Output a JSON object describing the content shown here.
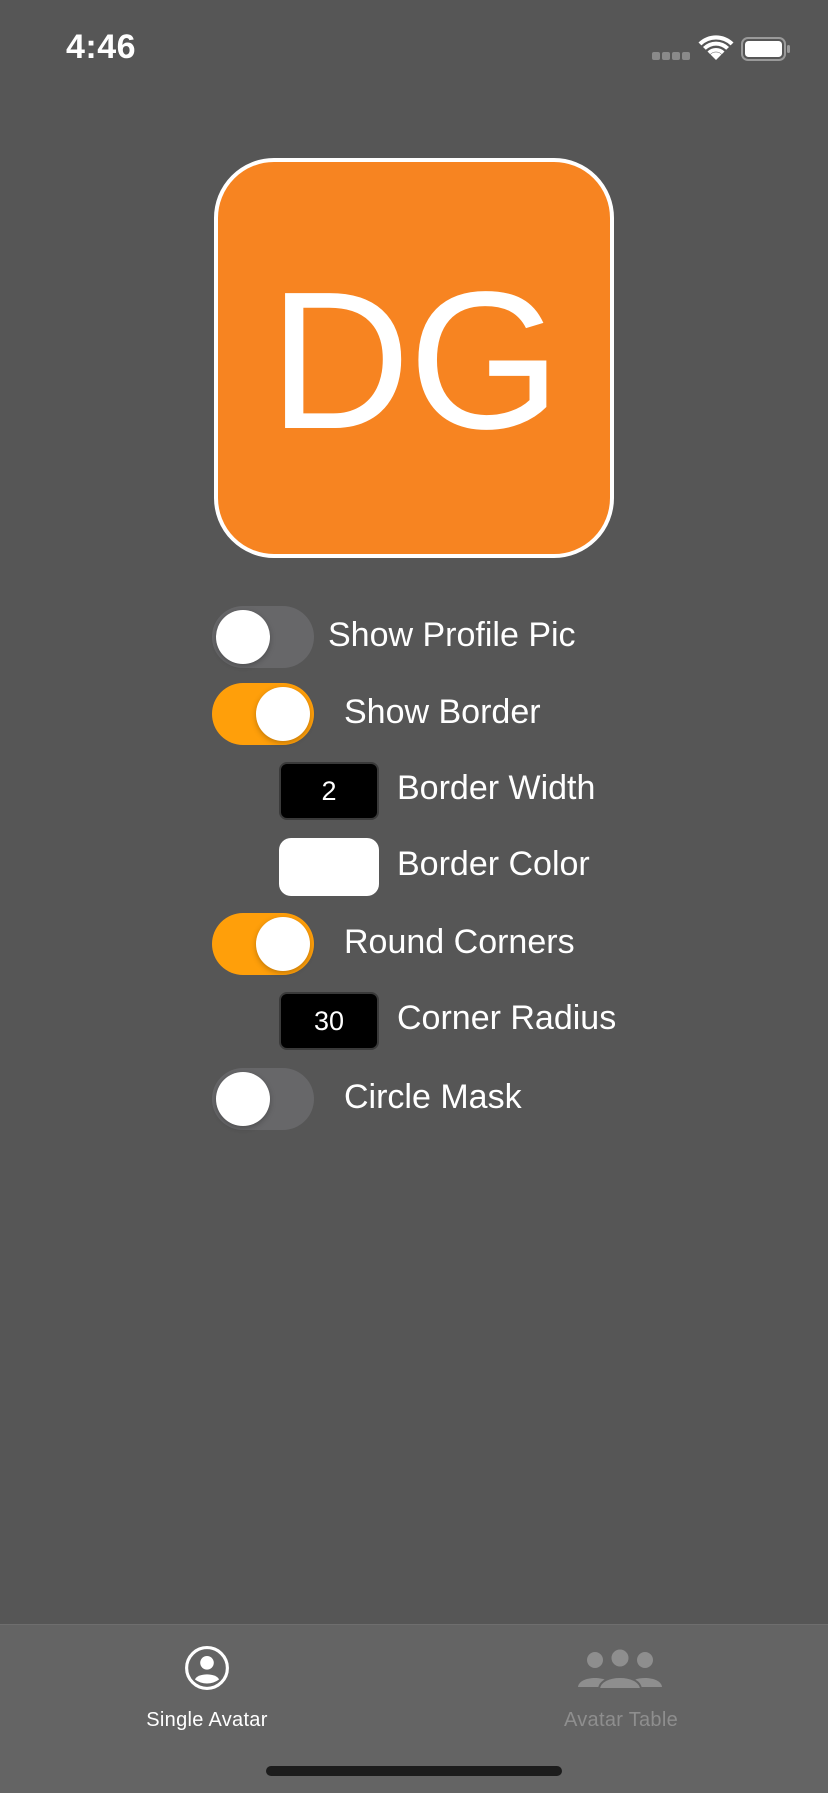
{
  "status_bar": {
    "time": "4:46",
    "icons": [
      "cellular-signal-icon",
      "wifi-icon",
      "battery-icon"
    ]
  },
  "avatar": {
    "initials": "DG",
    "background_color": "#F78421",
    "border_color": "#FFFFFF"
  },
  "options": {
    "show_profile_pic": {
      "label": "Show Profile Pic",
      "on": false
    },
    "show_border": {
      "label": "Show Border",
      "on": true
    },
    "border_width": {
      "label": "Border Width",
      "value": "2"
    },
    "border_color": {
      "label": "Border Color",
      "value": "#FFFFFF"
    },
    "round_corners": {
      "label": "Round Corners",
      "on": true
    },
    "corner_radius": {
      "label": "Corner Radius",
      "value": "30"
    },
    "circle_mask": {
      "label": "Circle Mask",
      "on": false
    }
  },
  "tab_bar": {
    "tabs": [
      {
        "label": "Single Avatar",
        "icon": "person-circle-icon",
        "selected": true
      },
      {
        "label": "Avatar Table",
        "icon": "group-icon",
        "selected": false
      }
    ]
  },
  "colors": {
    "background": "#565656",
    "accent": "#FF9F0A",
    "tab_bar": "#646464"
  }
}
